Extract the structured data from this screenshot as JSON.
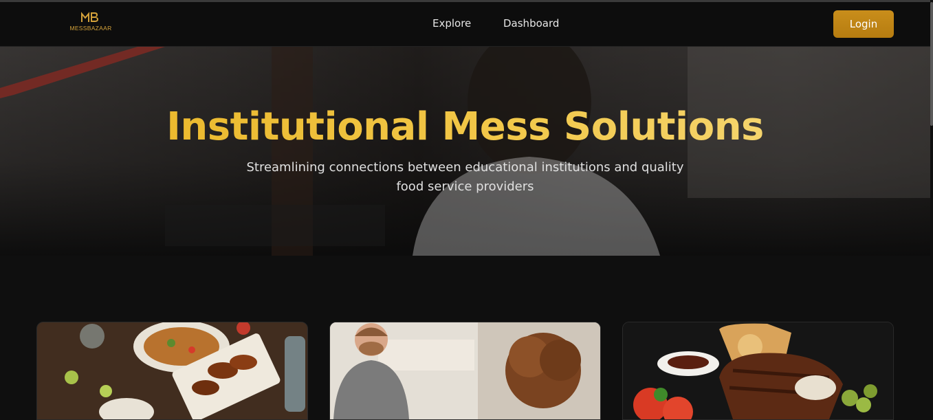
{
  "app": {
    "logo_text": "MESSBAZAAR",
    "logo_icon": "mb-monogram-icon",
    "brand_color": "#d4a23a"
  },
  "navbar": {
    "links": [
      {
        "label": "Explore"
      },
      {
        "label": "Dashboard"
      }
    ],
    "login_label": "Login",
    "login_color": "#c98e1b"
  },
  "hero": {
    "title": "Institutional Mess Solutions",
    "subtitle": "Streamlining connections between educational institutions and quality food service providers",
    "title_color": "#f2c84a"
  },
  "cards": [
    {
      "image": "food-spread-image"
    },
    {
      "image": "service-staff-image"
    },
    {
      "image": "grilled-meat-plate-image"
    }
  ]
}
